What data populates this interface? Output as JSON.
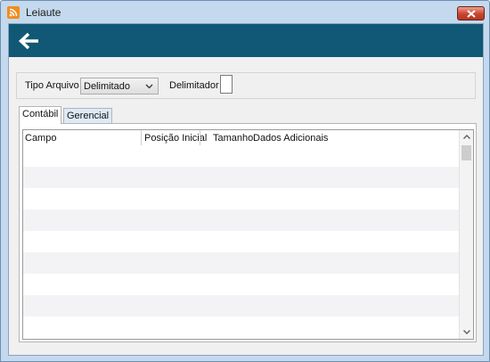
{
  "window": {
    "title": "Leiaute"
  },
  "filter": {
    "tipo_arquivo_label": "Tipo Arquivo",
    "tipo_arquivo_value": "Delimitado",
    "delimitador_label": "Delimitador",
    "delimitador_value": ""
  },
  "tabs": [
    {
      "label": "Contábil",
      "active": true
    },
    {
      "label": "Gerencial",
      "active": false
    }
  ],
  "grid": {
    "columns": [
      "Campo",
      "Posição Inicial",
      "Tamanho",
      "Dados Adicionais"
    ]
  },
  "colors": {
    "banner": "#105876",
    "window_frame": "#c4d9ee",
    "close_button": "#c7452e"
  }
}
